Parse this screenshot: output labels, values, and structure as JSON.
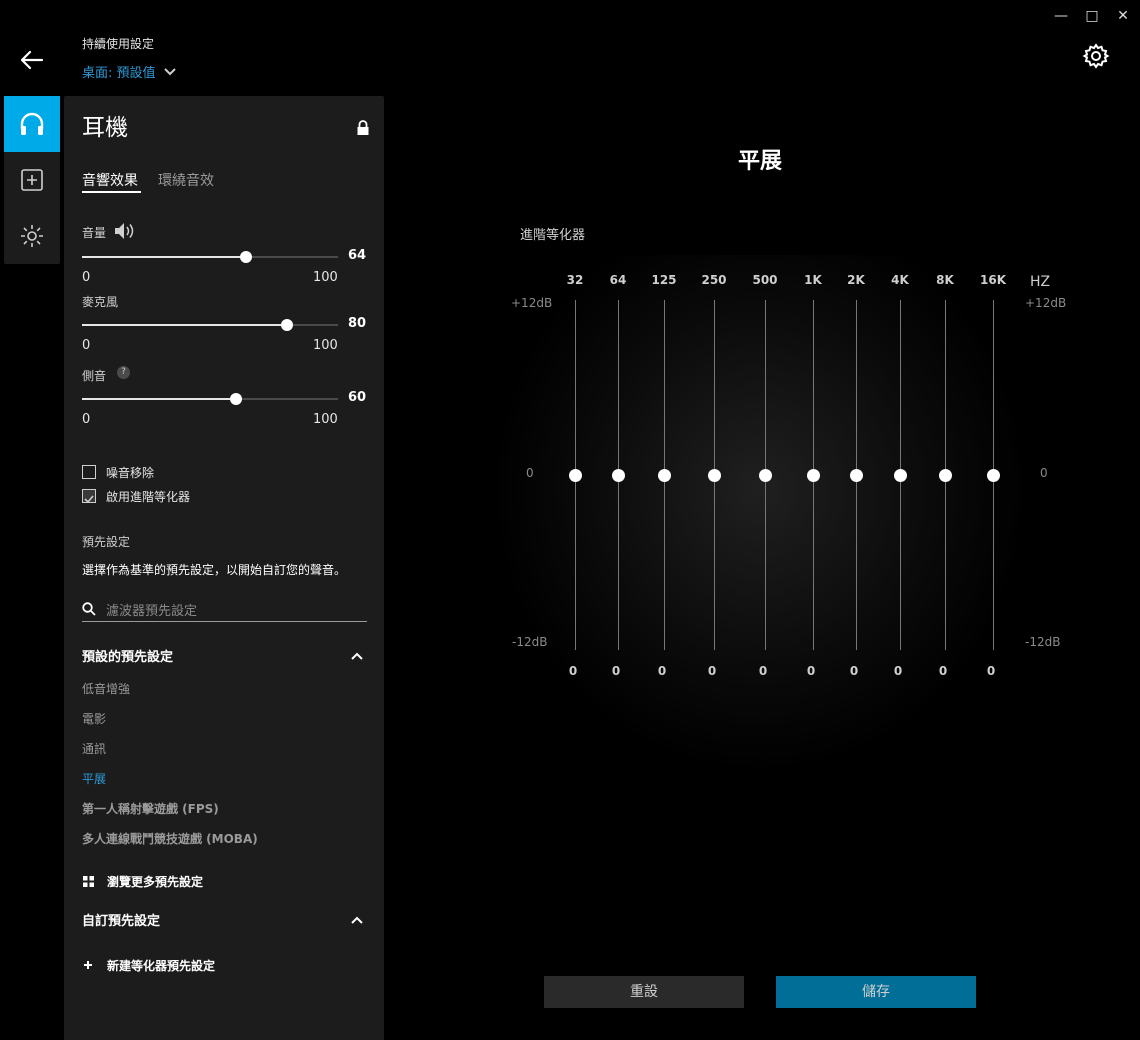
{
  "window": {
    "minimize": "—",
    "maximize": "□",
    "close": "✕"
  },
  "header": {
    "profile_label": "持續使用設定",
    "profile_value": "桌面: 預設值"
  },
  "rail": {
    "items": [
      "headset-icon",
      "add-device-icon",
      "lighting-icon"
    ],
    "active_color": "#00a9e8"
  },
  "panel": {
    "title": "耳機",
    "tabs": [
      "音響效果",
      "環繞音效"
    ],
    "sliders": [
      {
        "label": "音量",
        "value": 64,
        "min": "0",
        "max": "100",
        "value_text": "64"
      },
      {
        "label": "麥克風",
        "value": 80,
        "min": "0",
        "max": "100",
        "value_text": "80"
      },
      {
        "label": "側音",
        "value": 60,
        "min": "0",
        "max": "100",
        "value_text": "60"
      }
    ],
    "sidetone_help": "?",
    "checkboxes": [
      {
        "label": "噪音移除",
        "checked": false
      },
      {
        "label": "啟用進階等化器",
        "checked": true
      }
    ],
    "presets_heading": "預先設定",
    "presets_desc": "選擇作為基準的預先設定，以開始自訂您的聲音。",
    "search_placeholder": "濾波器預先設定",
    "default_presets_header": "預設的預先設定",
    "default_presets": [
      "低音增強",
      "電影",
      "通訊",
      "平展",
      "第一人稱射擊遊戲 (FPS)",
      "多人連線戰鬥競技遊戲 (MOBA)"
    ],
    "selected_preset": "平展",
    "browse_more": "瀏覽更多預先設定",
    "custom_presets_header": "自訂預先設定",
    "new_eq_preset": "新建等化器預先設定",
    "accent": "#2d9bd8"
  },
  "main": {
    "title": "平展",
    "eq_label": "進階等化器",
    "hz_label": "HZ",
    "db_top": "+12dB",
    "db_mid": "0",
    "db_bottom": "-12dB",
    "bands": [
      {
        "freq": "32",
        "value": "0"
      },
      {
        "freq": "64",
        "value": "0"
      },
      {
        "freq": "125",
        "value": "0"
      },
      {
        "freq": "250",
        "value": "0"
      },
      {
        "freq": "500",
        "value": "0"
      },
      {
        "freq": "1K",
        "value": "0"
      },
      {
        "freq": "2K",
        "value": "0"
      },
      {
        "freq": "4K",
        "value": "0"
      },
      {
        "freq": "8K",
        "value": "0"
      },
      {
        "freq": "16K",
        "value": "0"
      }
    ],
    "reset_label": "重設",
    "save_label": "儲存",
    "save_color": "#006e96"
  }
}
